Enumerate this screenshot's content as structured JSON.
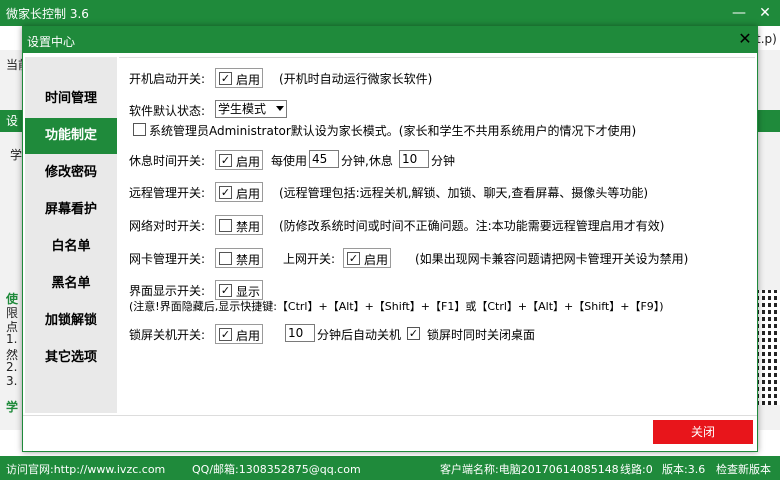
{
  "app": {
    "title": "微家长控制 3.6",
    "minimize": "—",
    "close": "✕",
    "bg_label_current": "当前",
    "bg_right_snippet": "t.p)",
    "bg_green_tab": "设",
    "bg_text_1": "学",
    "bg_left_lines": [
      "使",
      "限",
      "点",
      "1.",
      "然",
      "2.",
      "3."
    ],
    "bg_left_bottom": "学"
  },
  "footer": {
    "website": "访问官网:http://www.ivzc.com",
    "contact": "QQ/邮箱:1308352875@qq.com",
    "client": "客户端名称:电脑20170614085148",
    "line": "线路:0",
    "version": "版本:3.6",
    "update": "检查新版本"
  },
  "dialog": {
    "title": "设置中心",
    "close_icon": "✕",
    "close_button": "关闭"
  },
  "sidebar": {
    "items": [
      {
        "label": "时间管理",
        "active": false
      },
      {
        "label": "功能制定",
        "active": true
      },
      {
        "label": "修改密码",
        "active": false
      },
      {
        "label": "屏幕看护",
        "active": false
      },
      {
        "label": "白名单",
        "active": false
      },
      {
        "label": "黑名单",
        "active": false
      },
      {
        "label": "加锁解锁",
        "active": false
      },
      {
        "label": "其它选项",
        "active": false
      }
    ]
  },
  "settings": {
    "autostart": {
      "label": "开机启动开关:",
      "checkbox": "启用",
      "checked": true,
      "note": "(开机时自动运行微家长软件)"
    },
    "default_state": {
      "label": "软件默认状态:",
      "value": "学生模式",
      "admin_checkbox_checked": false,
      "admin_note": "系统管理员Administrator默认设为家长模式。(家长和学生不共用系统用户的情况下才使用)"
    },
    "rest": {
      "label": "休息时间开关:",
      "checkbox": "启用",
      "checked": true,
      "every_label": "每使用",
      "every_value": "45",
      "rest_label": "分钟,休息",
      "rest_value": "10",
      "unit": "分钟"
    },
    "remote": {
      "label": "远程管理开关:",
      "checkbox": "启用",
      "checked": true,
      "note": "(远程管理包括:远程关机,解锁、加锁、聊天,查看屏幕、摄像头等功能)"
    },
    "network_time": {
      "label": "网络对时开关:",
      "checkbox": "禁用",
      "checked": false,
      "note": "(防修改系统时间或时间不正确问题。注:本功能需要远程管理启用才有效)"
    },
    "nic": {
      "label": "网卡管理开关:",
      "checkbox": "禁用",
      "checked": false,
      "internet_label": "上网开关:",
      "internet_checkbox": "启用",
      "internet_checked": true,
      "note": "(如果出现网卡兼容问题请把网卡管理开关设为禁用)"
    },
    "ui_display": {
      "label": "界面显示开关:",
      "checkbox": "显示",
      "checked": true,
      "note": "(注意!界面隐藏后,显示快捷键:【Ctrl】+【Alt】+【Shift】+【F1】或【Ctrl】+【Alt】+【Shift】+【F9】)"
    },
    "lock_shutdown": {
      "label": "锁屏关机开关:",
      "checkbox": "启用",
      "checked": true,
      "minutes_value": "10",
      "minutes_label": "分钟后自动关机",
      "desktop_checked": true,
      "desktop_label": "锁屏时同时关闭桌面"
    }
  },
  "colors": {
    "accent": "#1f8a3b",
    "danger": "#e8151b"
  }
}
